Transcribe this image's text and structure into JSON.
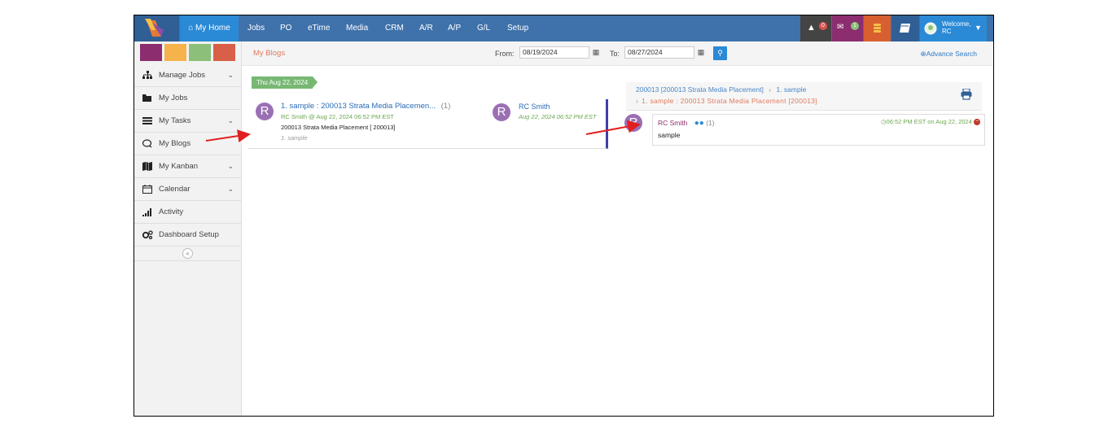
{
  "nav": {
    "home": "My Home",
    "items": [
      "Jobs",
      "PO",
      "eTime",
      "Media",
      "CRM",
      "A/R",
      "A/P",
      "G/L",
      "Setup"
    ],
    "notif_count": "0",
    "msg_count": "1",
    "welcome": "Welcome,",
    "user": "RC"
  },
  "sidebar": {
    "swatches": [
      "#8b2d6f",
      "#f6b24b",
      "#8cc07a",
      "#d85f48"
    ],
    "items": [
      {
        "label": "Manage Jobs",
        "icon": "sitemap-icon",
        "chev": true
      },
      {
        "label": "My Jobs",
        "icon": "folder-icon",
        "chev": false
      },
      {
        "label": "My Tasks",
        "icon": "tasks-icon",
        "chev": true
      },
      {
        "label": "My Blogs",
        "icon": "comments-icon",
        "chev": false
      },
      {
        "label": "My Kanban",
        "icon": "map-icon",
        "chev": true
      },
      {
        "label": "Calendar",
        "icon": "calendar-icon",
        "chev": true
      },
      {
        "label": "Activity",
        "icon": "signal-icon",
        "chev": false
      },
      {
        "label": "Dashboard Setup",
        "icon": "cogs-icon",
        "chev": false
      }
    ]
  },
  "toolbar": {
    "title": "My Blogs",
    "from_label": "From:",
    "from_value": "08/19/2024",
    "to_label": "To:",
    "to_value": "08/27/2024",
    "advance_search": "Advance Search"
  },
  "blog_list": {
    "date_tag": "Thu Aug 22, 2024",
    "entry": {
      "avatar": "R",
      "title": "1. sample : 200013 Strata Media Placemen...",
      "count": "(1)",
      "meta": "RC Smith @ Aug 22, 2024 06:52 PM EST",
      "job": "200013 Strata Media Placement [ 200013]",
      "subtitle": "1. sample",
      "author": "RC Smith",
      "author_time": "Aug 22, 2024 06:52 PM EST"
    }
  },
  "detail": {
    "crumb1": "200013 [200013 Strata Media Placement]",
    "crumb2": "1. sample",
    "crumb3": "1. sample : 200013 Strata Media Placement [200013]",
    "comment": {
      "avatar": "R",
      "author": "RC Smith",
      "count": "(1)",
      "time": "06:52 PM EST on Aug 22, 2024",
      "text": "sample"
    }
  }
}
